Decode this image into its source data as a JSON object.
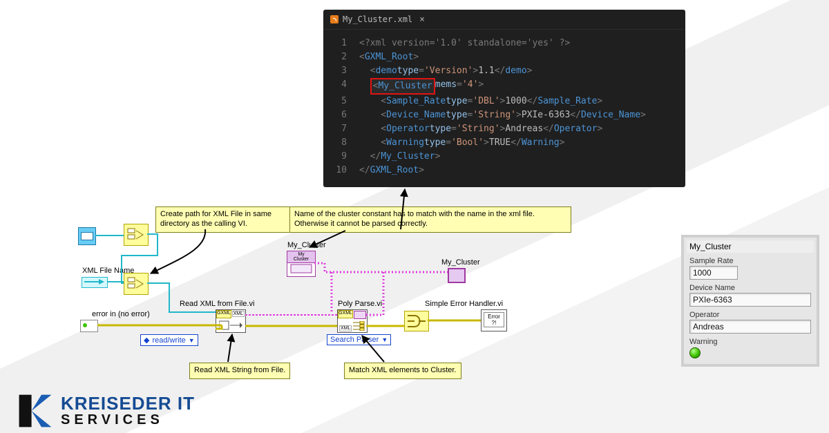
{
  "editor": {
    "filename": "My_Cluster.xml",
    "lines": [
      1,
      2,
      3,
      4,
      5,
      6,
      7,
      8,
      9,
      10
    ],
    "xml_declaration": "<?xml version='1.0' standalone='yes' ?>",
    "root_tag": "GXML_Root",
    "demo_tag": "demo",
    "demo_type_attr": "type",
    "demo_type_val": "Version",
    "demo_text": "1.1",
    "cluster_tag": "My_Cluster",
    "cluster_attr": "mems",
    "cluster_attr_val": "4",
    "sr_tag": "Sample_Rate",
    "sr_type": "DBL",
    "sr_val": "1000",
    "dn_tag": "Device_Name",
    "dn_type": "String",
    "dn_val": "PXIe-6363",
    "op_tag": "Operator",
    "op_type": "String",
    "op_val": "Andreas",
    "wn_tag": "Warning",
    "wn_type": "Bool",
    "wn_val": "TRUE"
  },
  "tips": {
    "path": "Create path for XML File in same directory as the calling VI.",
    "name_match": "Name of the cluster constant has to match with the name in the xml file. Otherwise it cannot be parsed correctly.",
    "read_string": "Read XML String from File.",
    "match": "Match XML elements to Cluster."
  },
  "labels": {
    "xml_file_name": "XML File Name",
    "my_cluster_top": "My_Cluster",
    "my_cluster_ind": "My_Cluster",
    "read_vi": "Read XML from File.vi",
    "parse_vi": "Poly Parse.vi",
    "error_vi": "Simple Error Handler.vi",
    "error_in": "error in (no error)",
    "ring_rw": "read/write",
    "ring_parser": "Search Parser"
  },
  "cluster": {
    "title": "My_Cluster",
    "sr_label": "Sample Rate",
    "sr_val": "1000",
    "dn_label": "Device Name",
    "dn_val": "PXIe-6363",
    "op_label": "Operator",
    "op_val": "Andreas",
    "wn_label": "Warning"
  },
  "logo": {
    "line1": "KREISEDER IT",
    "line2": "SERVICES"
  }
}
